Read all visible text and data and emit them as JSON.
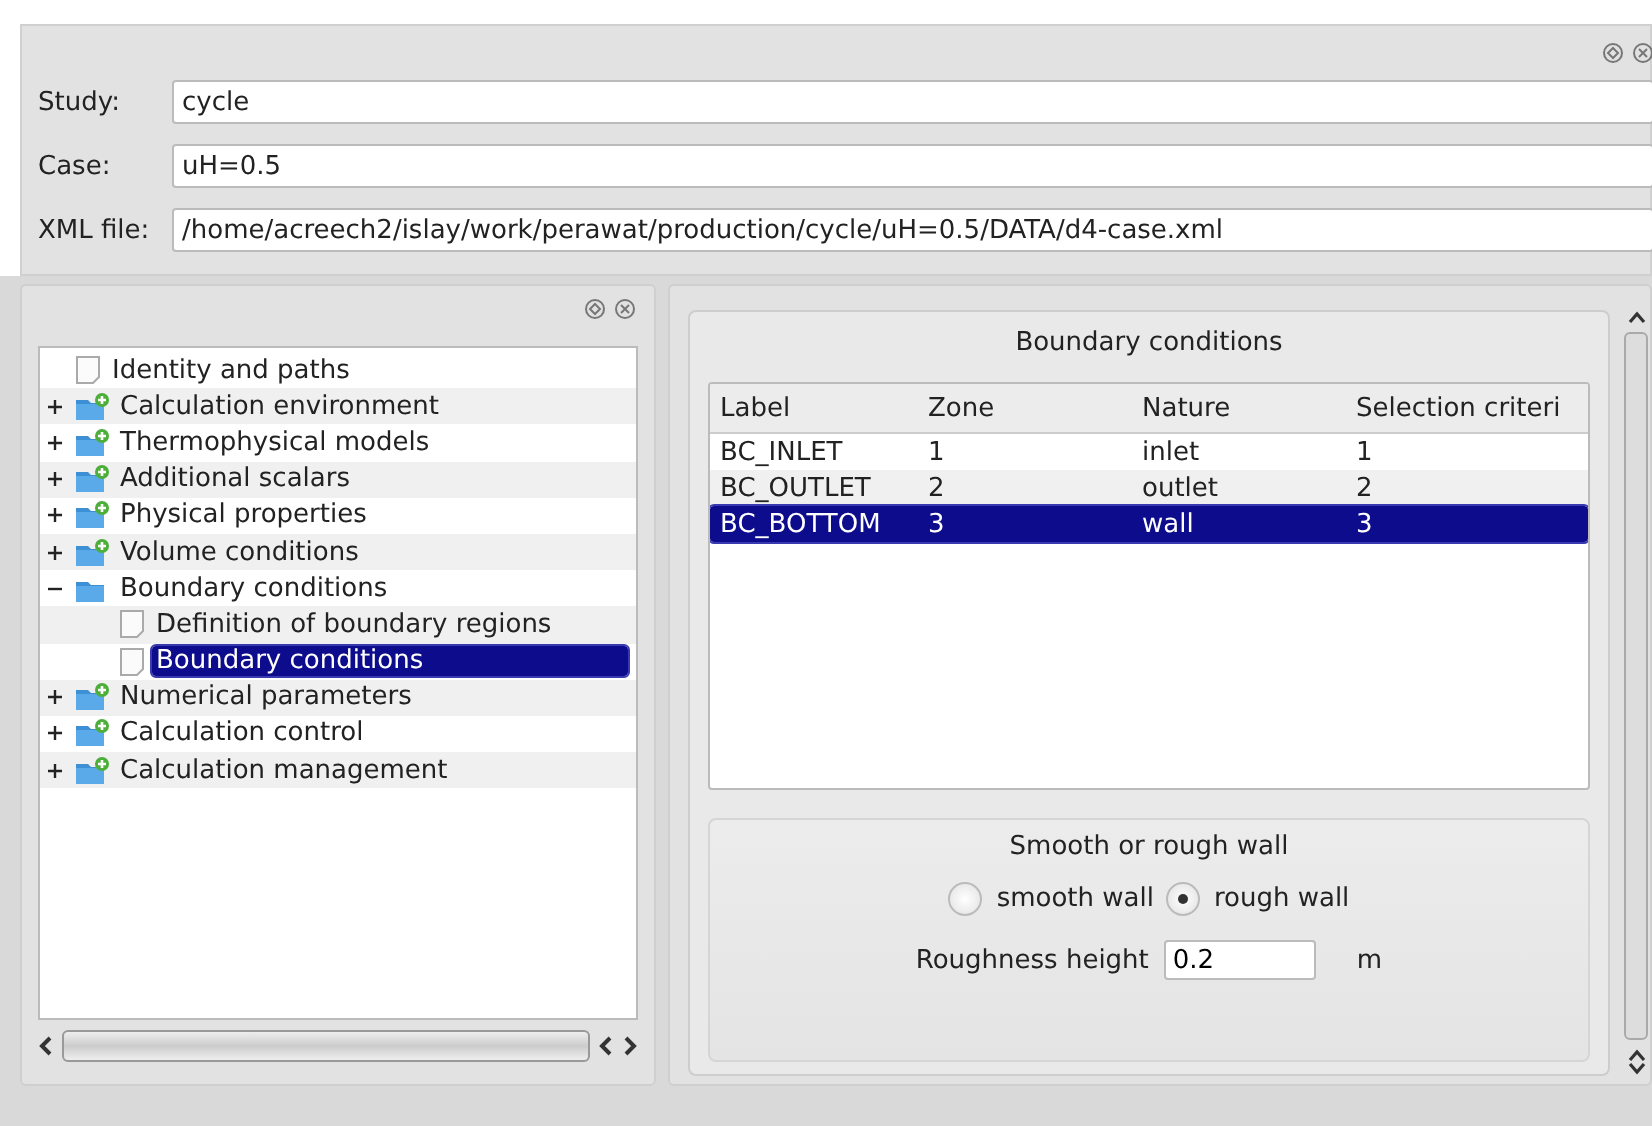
{
  "study": {
    "label": "Study:",
    "value": "cycle"
  },
  "case": {
    "label": "Case:",
    "value": "uH=0.5"
  },
  "xml_file": {
    "label": "XML file:",
    "value": "/home/acreech2/islay/work/perawat/production/cycle/uH=0.5/DATA/d4-case.xml"
  },
  "tree": {
    "items": [
      {
        "label": "Identity and paths",
        "kind": "page",
        "selected": false
      },
      {
        "label": "Calculation environment",
        "kind": "folder",
        "expanded": false,
        "selected": false
      },
      {
        "label": "Thermophysical models",
        "kind": "folder",
        "expanded": false,
        "selected": false
      },
      {
        "label": "Additional scalars",
        "kind": "folder",
        "expanded": false,
        "selected": false
      },
      {
        "label": "Physical properties",
        "kind": "folder",
        "expanded": false,
        "selected": false
      },
      {
        "label": "Volume conditions",
        "kind": "folder",
        "expanded": false,
        "selected": false
      },
      {
        "label": "Boundary conditions",
        "kind": "folder",
        "expanded": true,
        "selected": false,
        "children": [
          {
            "label": "Definition of boundary regions",
            "kind": "page",
            "selected": false
          },
          {
            "label": "Boundary conditions",
            "kind": "page",
            "selected": true
          }
        ]
      },
      {
        "label": "Numerical parameters",
        "kind": "folder",
        "expanded": false,
        "selected": false
      },
      {
        "label": "Calculation control",
        "kind": "folder",
        "expanded": false,
        "selected": false
      },
      {
        "label": "Calculation management",
        "kind": "folder",
        "expanded": false,
        "selected": false
      }
    ]
  },
  "panel": {
    "title": "Boundary conditions",
    "table": {
      "columns": [
        "Label",
        "Zone",
        "Nature",
        "Selection criteri"
      ],
      "rows": [
        {
          "cells": [
            "BC_INLET",
            "1",
            "inlet",
            "1"
          ],
          "selected": false
        },
        {
          "cells": [
            "BC_OUTLET",
            "2",
            "outlet",
            "2"
          ],
          "selected": false
        },
        {
          "cells": [
            "BC_BOTTOM",
            "3",
            "wall",
            "3"
          ],
          "selected": true
        }
      ]
    },
    "wall": {
      "title": "Smooth or rough wall",
      "options": [
        {
          "label": "smooth wall",
          "selected": false
        },
        {
          "label": "rough wall",
          "selected": true
        }
      ],
      "roughness": {
        "label": "Roughness height",
        "value": "0.2",
        "unit": "m"
      }
    }
  }
}
